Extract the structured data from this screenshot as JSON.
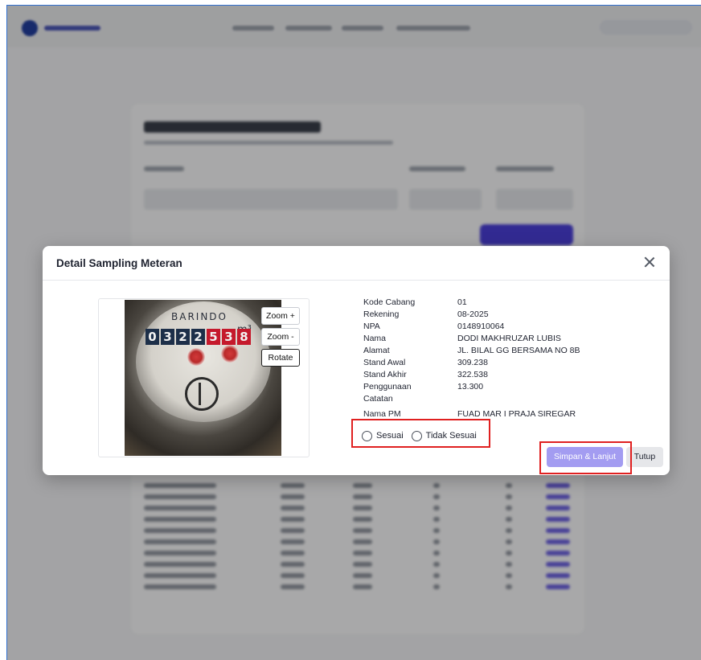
{
  "modal": {
    "title": "Detail Sampling Meteran",
    "fields": [
      {
        "label": "Kode Cabang",
        "value": "01"
      },
      {
        "label": "Rekening",
        "value": "08-2025"
      },
      {
        "label": "NPA",
        "value": "0148910064"
      },
      {
        "label": "Nama",
        "value": "DODI MAKHRUZAR LUBIS"
      },
      {
        "label": "Alamat",
        "value": "JL. BILAL GG BERSAMA NO 8B"
      },
      {
        "label": "Stand Awal",
        "value": "309.238"
      },
      {
        "label": "Stand Akhir",
        "value": "322.538"
      },
      {
        "label": "Penggunaan",
        "value": "13.300"
      },
      {
        "label": "Catatan",
        "value": ""
      },
      {
        "label": "Nama PM",
        "value": "FUAD MAR I PRAJA SIREGAR"
      }
    ],
    "options": {
      "sesuai": "Sesuai",
      "tidak_sesuai": "Tidak Sesuai"
    },
    "zoom_in": "Zoom +",
    "zoom_out": "Zoom -",
    "rotate": "Rotate",
    "save_label": "Simpan & Lanjut",
    "close_label": "Tutup",
    "close_icon": "close-icon"
  },
  "meter_photo": {
    "brand": "BARINDO",
    "digits": [
      "0",
      "3",
      "2",
      "2",
      "5",
      "3",
      "8"
    ],
    "unit": "m³"
  },
  "colors": {
    "accent": "#a39cf1",
    "highlight": "#e02020",
    "primary_bg": "#4a3fd8"
  }
}
